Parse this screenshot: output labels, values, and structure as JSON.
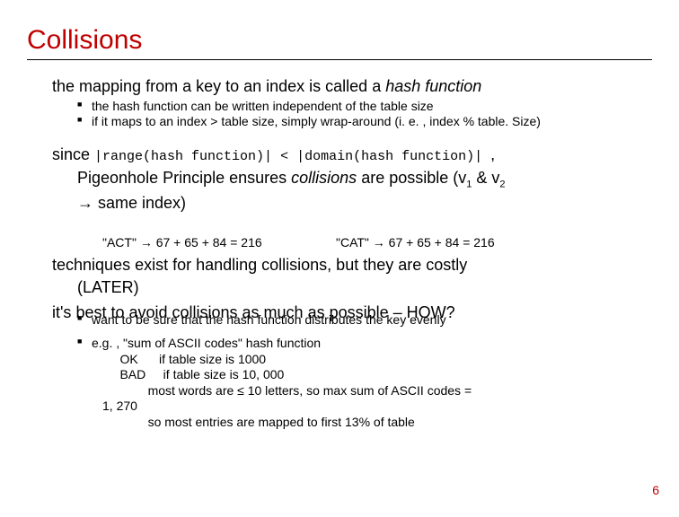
{
  "title": "Collisions",
  "page": "6",
  "p1": {
    "lead_a": "the mapping from a key to an index is called a ",
    "lead_b": "hash function",
    "sub1": "the hash function can be written independent of the table size",
    "sub2": "if it maps to an index > table size, simply wrap-around (i. e. , index % table. Size)"
  },
  "p2": {
    "since": "since ",
    "math": "|range(hash function)| < |domain(hash function)| ",
    "comma": ",",
    "pigeon_a": "Pigeonhole Principle ensures ",
    "collisions": "collisions",
    "pigeon_b": " are possible (v",
    "s1": "1",
    "amp": " & v",
    "s2": "2",
    "same": "→ same index)"
  },
  "ex": {
    "a": "\"ACT\" → 67 + 65 + 84 = 216",
    "b": "\"CAT\" → 67 + 65 + 84 = 216"
  },
  "p3": {
    "l1": "techniques exist for handling collisions, but they are costly",
    "l2": "(LATER)"
  },
  "p4": {
    "l1": "it's best to avoid collisions as much as possible – HOW?",
    "sub1": "want to be sure that the hash function distributes the key evenly"
  },
  "p5": {
    "head": "e.g. , \"sum of ASCII codes\" hash function",
    "r1": "     OK      if table size is 1000",
    "r2": "     BAD     if table size is 10, 000",
    "r3": "             most words are ≤ 10 letters, so max sum of ASCII codes =",
    "r4": "1, 270",
    "r5": "             so most entries are mapped to first 13% of table"
  }
}
